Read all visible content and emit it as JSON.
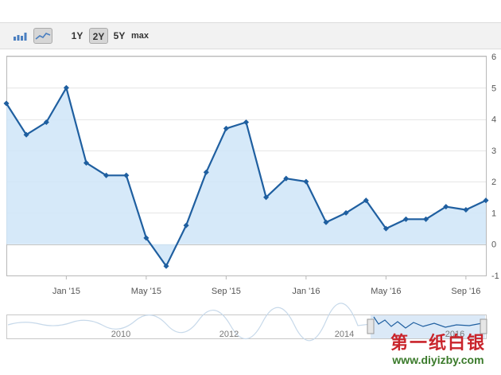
{
  "toolbar": {
    "chart_type_icons": [
      "bar-chart-icon",
      "line-chart-icon"
    ],
    "ranges": [
      "1Y",
      "2Y",
      "5Y",
      "max"
    ],
    "active_range": "2Y"
  },
  "chart_data": {
    "type": "area",
    "x": [
      "2014-10",
      "2014-11",
      "2014-12",
      "2015-01",
      "2015-02",
      "2015-03",
      "2015-04",
      "2015-05",
      "2015-06",
      "2015-07",
      "2015-08",
      "2015-09",
      "2015-10",
      "2015-11",
      "2015-12",
      "2016-01",
      "2016-02",
      "2016-03",
      "2016-04",
      "2016-05",
      "2016-06",
      "2016-07",
      "2016-08",
      "2016-09",
      "2016-10"
    ],
    "series": [
      {
        "values": [
          4.5,
          3.5,
          3.9,
          5.0,
          2.6,
          2.2,
          2.2,
          0.2,
          -0.7,
          0.6,
          2.3,
          3.7,
          3.9,
          1.5,
          2.1,
          2.0,
          0.7,
          1.0,
          1.4,
          0.5,
          0.8,
          0.8,
          1.2,
          1.1,
          1.4
        ]
      }
    ],
    "x_tick_labels": [
      "Jan '15",
      "May '15",
      "Sep '15",
      "Jan '16",
      "May '16",
      "Sep '16"
    ],
    "x_tick_dates": [
      "2015-01",
      "2015-05",
      "2015-09",
      "2016-01",
      "2016-05",
      "2016-09"
    ],
    "y_ticks": [
      -1,
      0,
      1,
      2,
      3,
      4,
      5,
      6
    ],
    "ylim": [
      -1,
      6
    ],
    "y_axis_side": "right",
    "grid": true,
    "navigator_labels": [
      "2010",
      "2012",
      "2014",
      "2016"
    ],
    "line_color": "#1f5fa0",
    "fill_color": "#cfe5f8"
  },
  "watermark": {
    "text_cn": "第一纸白银",
    "url": "www.diyizby.com"
  }
}
